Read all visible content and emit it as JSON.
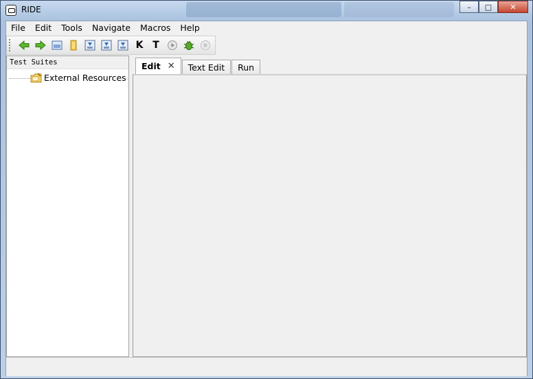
{
  "window": {
    "title": "RIDE",
    "controls": {
      "minimize": "–",
      "maximize": "□",
      "close": "✕"
    }
  },
  "menu": [
    "File",
    "Edit",
    "Tools",
    "Navigate",
    "Macros",
    "Help"
  ],
  "toolbar": {
    "icons": [
      "back-icon",
      "forward-icon",
      "open-icon",
      "open-directory-icon",
      "save-icon",
      "save-all-icon",
      "save-as-icon",
      "search-keywords-icon",
      "search-tests-icon",
      "run-icon",
      "debug-icon",
      "stop-icon"
    ],
    "keyword_letter": "K",
    "tests_letter": "T"
  },
  "tree": {
    "header": "Test Suites",
    "items": [
      {
        "label": "External Resources",
        "icon": "folder-resource-icon"
      }
    ]
  },
  "tabs": [
    {
      "label": "Edit",
      "active": true,
      "closable": true
    },
    {
      "label": "Text Edit",
      "active": false
    },
    {
      "label": "Run",
      "active": false
    }
  ],
  "tab_close_glyph": "✕"
}
